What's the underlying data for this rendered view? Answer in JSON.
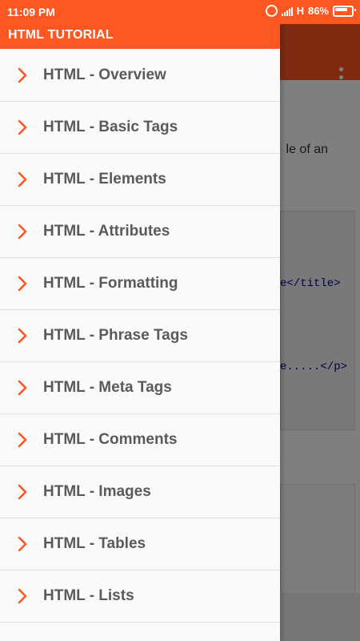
{
  "status_bar": {
    "time": "11:09 PM",
    "network": "H",
    "battery": "86%"
  },
  "drawer": {
    "title": "HTML TUTORIAL",
    "items": [
      {
        "label": "HTML - Overview"
      },
      {
        "label": "HTML - Basic Tags"
      },
      {
        "label": "HTML - Elements"
      },
      {
        "label": "HTML - Attributes"
      },
      {
        "label": "HTML - Formatting"
      },
      {
        "label": "HTML - Phrase Tags"
      },
      {
        "label": "HTML - Meta Tags"
      },
      {
        "label": "HTML - Comments"
      },
      {
        "label": "HTML - Images"
      },
      {
        "label": "HTML - Tables"
      },
      {
        "label": "HTML - Lists"
      }
    ]
  },
  "background_content": {
    "partial_text": "le of an",
    "code_line_1": "e</title>",
    "code_line_2": "e.....</p>"
  },
  "colors": {
    "accent": "#ff5722",
    "label_text": "#5a5a5a",
    "drawer_bg": "#fafafa"
  }
}
